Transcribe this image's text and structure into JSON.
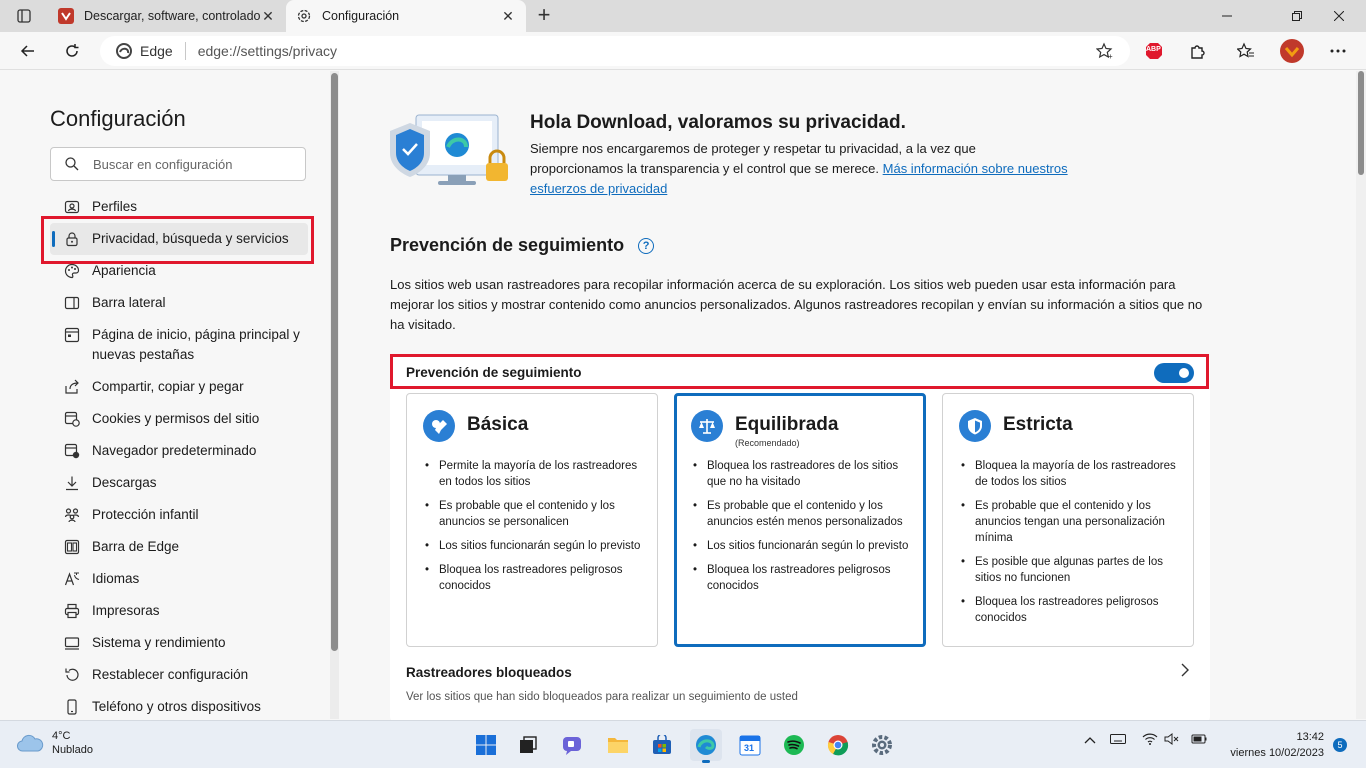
{
  "browser": {
    "tabs": [
      {
        "title": "Descargar, software, controladores",
        "active": false
      },
      {
        "title": "Configuración",
        "active": true
      }
    ],
    "address": {
      "site_label": "Edge",
      "url": "edge://settings/privacy"
    },
    "extensions": {
      "abp_label": "ABP"
    }
  },
  "sidebar": {
    "title": "Configuración",
    "search_placeholder": "Buscar en configuración",
    "items": [
      {
        "label": "Perfiles",
        "icon": "profile-icon"
      },
      {
        "label": "Privacidad, búsqueda y servicios",
        "icon": "lock-icon"
      },
      {
        "label": "Apariencia",
        "icon": "palette-icon"
      },
      {
        "label": "Barra lateral",
        "icon": "sidebar-icon"
      },
      {
        "label": "Página de inicio, página principal y nuevas pestañas",
        "icon": "home-icon"
      },
      {
        "label": "Compartir, copiar y pegar",
        "icon": "share-icon"
      },
      {
        "label": "Cookies y permisos del sitio",
        "icon": "cookies-icon"
      },
      {
        "label": "Navegador predeterminado",
        "icon": "browser-icon"
      },
      {
        "label": "Descargas",
        "icon": "download-icon"
      },
      {
        "label": "Protección infantil",
        "icon": "family-icon"
      },
      {
        "label": "Barra de Edge",
        "icon": "edge-bar-icon"
      },
      {
        "label": "Idiomas",
        "icon": "language-icon"
      },
      {
        "label": "Impresoras",
        "icon": "printer-icon"
      },
      {
        "label": "Sistema y rendimiento",
        "icon": "system-icon"
      },
      {
        "label": "Restablecer configuración",
        "icon": "reset-icon"
      },
      {
        "label": "Teléfono y otros dispositivos",
        "icon": "phone-icon"
      }
    ]
  },
  "main": {
    "hero": {
      "title": "Hola Download, valoramos su privacidad.",
      "text": "Siempre nos encargaremos de proteger y respetar tu privacidad, a la vez que proporcionamos la transparencia y el control que se merece.",
      "link": "Más información sobre nuestros esfuerzos de privacidad"
    },
    "tracking": {
      "title": "Prevención de seguimiento",
      "description": "Los sitios web usan rastreadores para recopilar información acerca de su exploración. Los sitios web pueden usar esta información para mejorar los sitios y mostrar contenido como anuncios personalizados. Algunos rastreadores recopilan y envían su información a sitios que no ha visitado.",
      "toggle_label": "Prevención de seguimiento",
      "toggle_on": true,
      "options": [
        {
          "name": "Básica",
          "subtitle": "",
          "selected": false,
          "bullets": [
            "Permite la mayoría de los rastreadores en todos los sitios",
            "Es probable que el contenido y los anuncios se personalicen",
            "Los sitios funcionarán según lo previsto",
            "Bloquea los rastreadores peligrosos conocidos"
          ]
        },
        {
          "name": "Equilibrada",
          "subtitle": "(Recomendado)",
          "selected": true,
          "bullets": [
            "Bloquea los rastreadores de los sitios que no ha visitado",
            "Es probable que el contenido y los anuncios estén menos personalizados",
            "Los sitios funcionarán según lo previsto",
            "Bloquea los rastreadores peligrosos conocidos"
          ]
        },
        {
          "name": "Estricta",
          "subtitle": "",
          "selected": false,
          "bullets": [
            "Bloquea la mayoría de los rastreadores de todos los sitios",
            "Es probable que el contenido y los anuncios tengan una personalización mínima",
            "Es posible que algunas partes de los sitios no funcionen",
            "Bloquea los rastreadores peligrosos conocidos"
          ]
        }
      ],
      "blocked_title": "Rastreadores bloqueados",
      "blocked_desc": "Ver los sitios que han sido bloqueados para realizar un seguimiento de usted"
    }
  },
  "taskbar": {
    "weather_temp": "4°C",
    "weather_desc": "Nublado",
    "time": "13:42",
    "date": "viernes 10/02/2023",
    "notifications": "5",
    "calendar_day": "31"
  },
  "colors": {
    "accent": "#0f6cbd",
    "highlight": "#e0182d"
  }
}
